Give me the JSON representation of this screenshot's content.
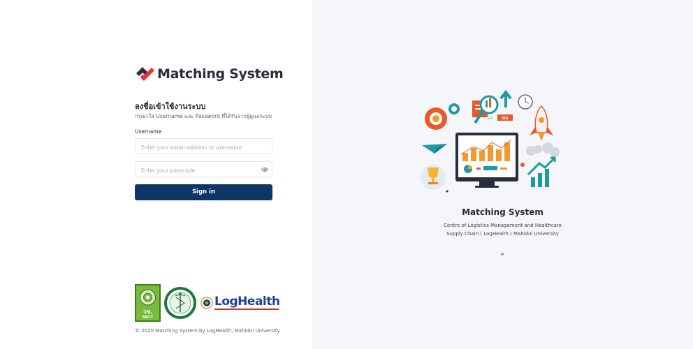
{
  "brand": {
    "name": "Matching System",
    "logo_icon": "checkmark-tile-icon"
  },
  "login": {
    "heading": "ลงชื่อเข้าใช้งานระบบ",
    "subheading": "กรุณาใส่ Username และ Password ที่ได้รับจากผู้ดูแลระบบ",
    "username_label": "Username",
    "username_placeholder": "Enter your email address or username",
    "password_placeholder": "Enter your passcode",
    "signin_label": "Sign in"
  },
  "partners": {
    "nrct_text": "วช.",
    "nrct_sub": "NRCT",
    "loghealth_text": "LogHealth"
  },
  "footer": {
    "copyright": "© 2020 Matching System by LogHealth, Mahidol University"
  },
  "showcase": {
    "title": "Matching System",
    "description": "Centre of Logistics Management and Healthcare Supply Chain ( LogHealth ) Mahidol University",
    "illustration_go_label": "Go",
    "illustration_seo_label": "SEO",
    "slides_total": 1,
    "active_slide": 1
  },
  "colors": {
    "primary": "#0d3565",
    "brand_red": "#e5323b",
    "brand_dark": "#2a2d3a",
    "panel_bg": "#f4f6fa",
    "accent_orange": "#f29b2c",
    "accent_teal": "#1e9aa5"
  }
}
